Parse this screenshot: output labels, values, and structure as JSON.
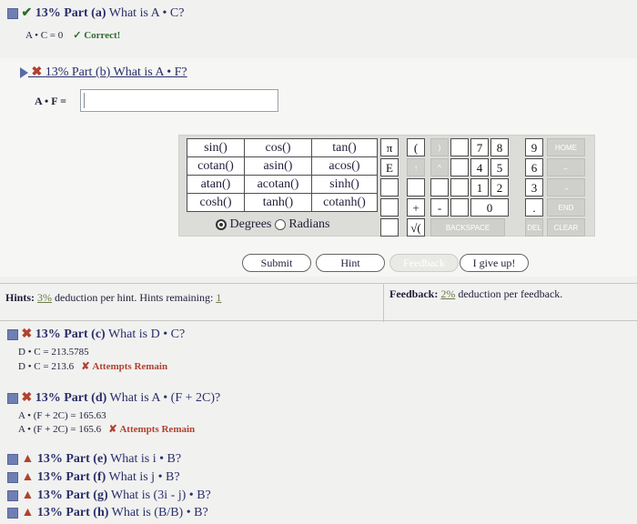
{
  "part_a": {
    "title_percent": "13% Part (a)",
    "title_question": "What is A • C?",
    "answer_expr": "A • C = 0",
    "status": "Correct!"
  },
  "part_b": {
    "title": "13% Part (b)  What is A • F?",
    "input_label": "A • F =",
    "input_value": ""
  },
  "calculator": {
    "functions": [
      [
        "sin()",
        "cos()",
        "tan()"
      ],
      [
        "cotan()",
        "asin()",
        "acos()"
      ],
      [
        "atan()",
        "acotan()",
        "sinh()"
      ],
      [
        "cosh()",
        "tanh()",
        "cotanh()"
      ]
    ],
    "angle_mode_degrees": "Degrees",
    "angle_mode_radians": "Radians",
    "keys": {
      "pi": "π",
      "e": "E",
      "open_paren": "(",
      "close_paren": ")",
      "up": "↑",
      "caret": "^",
      "n7": "7",
      "n8": "8",
      "n9": "9",
      "n4": "4",
      "n5": "5",
      "n6": "6",
      "n1": "1",
      "n2": "2",
      "n3": "3",
      "n0": "0",
      "dot": ".",
      "plus": "+",
      "minus": "-",
      "sqrt": "√(",
      "home": "HOME",
      "back_arrow": "←",
      "fwd_arrow": "→",
      "end": "END",
      "backspace": "BACKSPACE",
      "del": "DEL",
      "clear": "CLEAR"
    }
  },
  "buttons": {
    "submit": "Submit",
    "hint": "Hint",
    "feedback": "Feedback",
    "give_up": "I give up!"
  },
  "hints": {
    "label": "Hints:",
    "deduction": "3%",
    "text": "deduction per hint. Hints remaining:",
    "remaining": "1"
  },
  "feedback": {
    "label": "Feedback:",
    "deduction": "2%",
    "text": "deduction per feedback."
  },
  "part_c": {
    "title_percent": "13% Part (c)",
    "title_question": "What is D • C?",
    "line1": "D • C = 213.5785",
    "line2": "D • C = 213.6",
    "status": "Attempts Remain"
  },
  "part_d": {
    "title_percent": "13% Part (d)",
    "title_question": "What is A • (F + 2C)?",
    "line1": "A • (F + 2C) = 165.63",
    "line2": "A • (F + 2C) = 165.6",
    "status": "Attempts Remain"
  },
  "parts_rest": [
    {
      "percent": "13% Part (e)",
      "question": "What is i • B?"
    },
    {
      "percent": "13% Part (f)",
      "question": "What is j • B?"
    },
    {
      "percent": "13% Part (g)",
      "question": "What is (3i - j) • B?"
    },
    {
      "percent": "13% Part (h)",
      "question": "What is (B/B) • B?"
    }
  ],
  "colors": {
    "part_title": "#2a2f6b",
    "correct_green": "#2f6b2f",
    "wrong_red": "#b0422f",
    "icon_blue": "#6f7fb3"
  }
}
